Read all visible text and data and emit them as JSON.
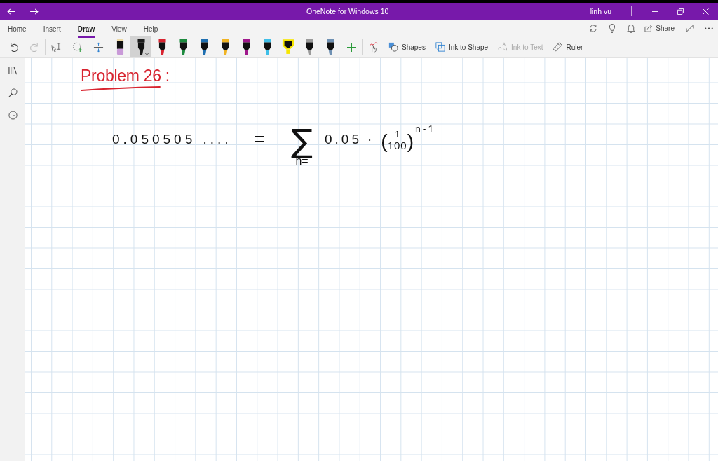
{
  "window": {
    "title": "OneNote for Windows 10",
    "user": "linh vu"
  },
  "tabs": [
    {
      "label": "Home",
      "selected": false
    },
    {
      "label": "Insert",
      "selected": false
    },
    {
      "label": "Draw",
      "selected": true
    },
    {
      "label": "View",
      "selected": false
    },
    {
      "label": "Help",
      "selected": false
    }
  ],
  "header": {
    "share_label": "Share"
  },
  "toolbar": {
    "undo": {
      "disabled": false
    },
    "redo": {
      "disabled": true
    },
    "pens": [
      {
        "kind": "eraser",
        "color": "#c99ad8",
        "selected": false
      },
      {
        "kind": "pen",
        "color": "#1a1a1a",
        "selected": true
      },
      {
        "kind": "pen",
        "color": "#d8232f",
        "selected": false
      },
      {
        "kind": "pen",
        "color": "#1d8a3e",
        "selected": false
      },
      {
        "kind": "pen",
        "color": "#1f6fb0",
        "selected": false
      },
      {
        "kind": "pen",
        "color": "#f0b323",
        "selected": false
      },
      {
        "kind": "pen",
        "color": "#a0198c",
        "selected": false
      },
      {
        "kind": "pen",
        "color": "#3fbfe8",
        "selected": false
      },
      {
        "kind": "highlighter",
        "color": "#f7e600",
        "selected": false
      },
      {
        "kind": "pencil",
        "color": "#9b9b9b",
        "selected": false
      },
      {
        "kind": "pen",
        "color": "#6f91b3",
        "selected": false
      }
    ],
    "tools": [
      {
        "label": "Shapes",
        "disabled": false
      },
      {
        "label": "Ink to Shape",
        "disabled": false
      },
      {
        "label": "Ink to Text",
        "disabled": true
      },
      {
        "label": "Ruler",
        "disabled": false
      }
    ]
  },
  "page": {
    "title": "Problem 26 :",
    "equation": {
      "lhs": "0.050505 ....",
      "equals": "=",
      "sum_sign": "∑",
      "sum_lower": "n=",
      "coefficient": "0.05",
      "dot": "·",
      "open_paren": "(",
      "numerator": "1",
      "denominator": "100",
      "close_paren": ")",
      "exponent": "n-1"
    }
  }
}
